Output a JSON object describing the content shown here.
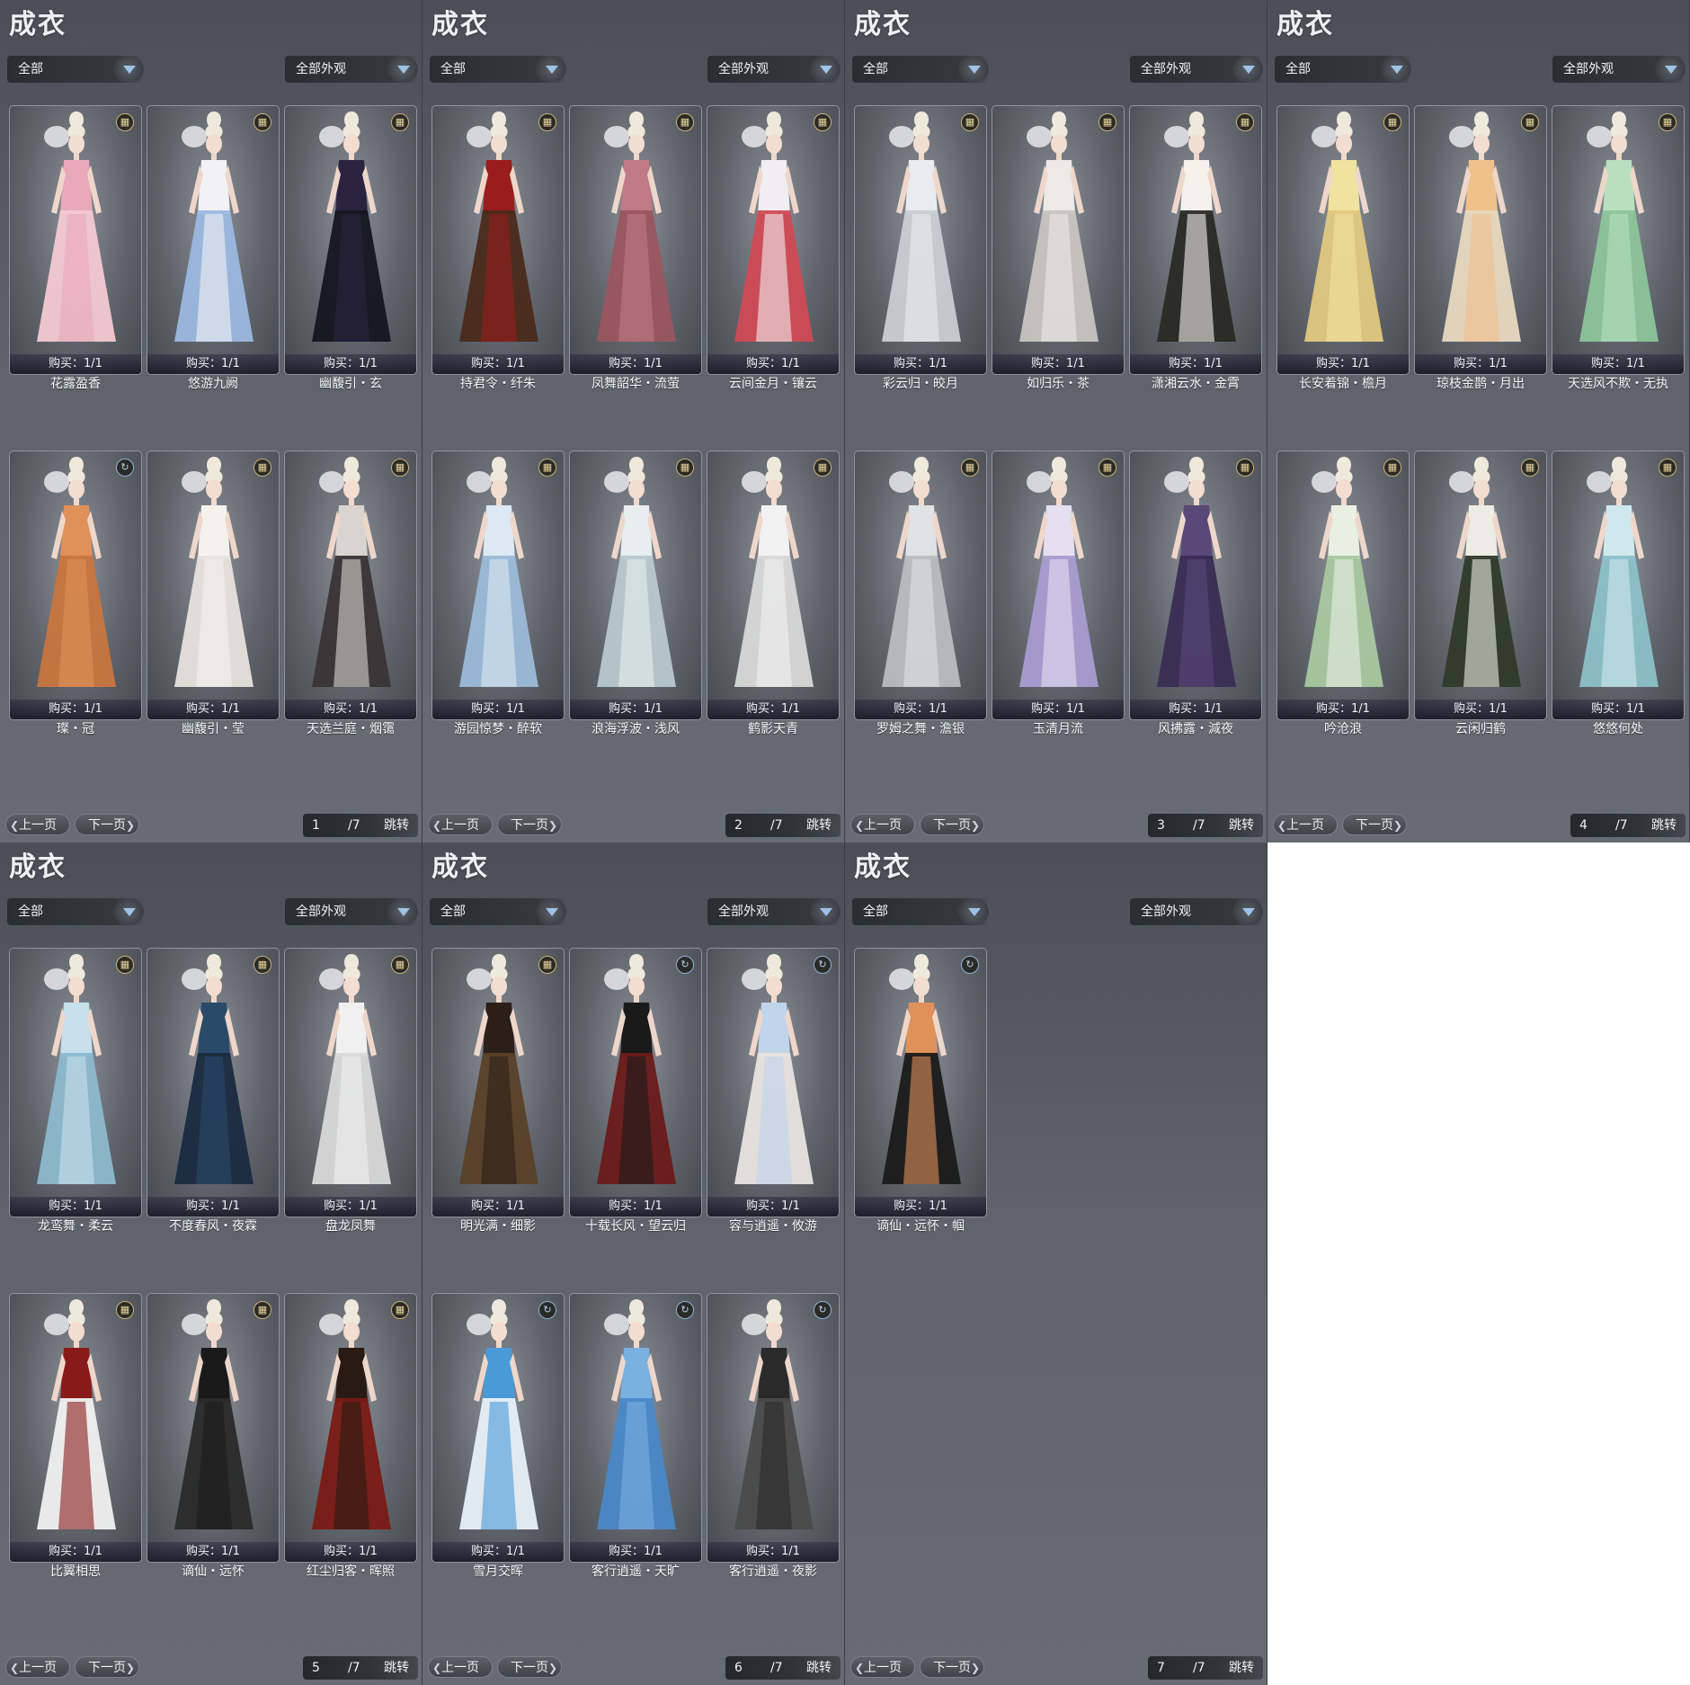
{
  "panel_title": "成衣",
  "filter_left": "全部",
  "filter_right": "全部外观",
  "prev_label": "上一页",
  "next_label": "下一页",
  "jump_label": "跳转",
  "total_pages": "/7",
  "panels": [
    {
      "page": "1",
      "items": [
        {
          "name": "花露盈香",
          "buy": "购买：1/1",
          "icon": "trash-icon",
          "colors": [
            "#e9a9b8",
            "#f3c9d2"
          ]
        },
        {
          "name": "悠游九阙",
          "buy": "购买：1/1",
          "icon": "trash-icon",
          "colors": [
            "#f2f2f4",
            "#9bb8e0"
          ]
        },
        {
          "name": "幽馥引・玄",
          "buy": "购买：1/1",
          "icon": "trash-icon",
          "colors": [
            "#2a2440",
            "#151520"
          ]
        },
        {
          "name": "璨・冠",
          "buy": "购买：1/1",
          "icon": "refresh-icon",
          "colors": [
            "#e0915a",
            "#c8763e"
          ]
        },
        {
          "name": "幽馥引・莹",
          "buy": "购买：1/1",
          "icon": "trash-icon",
          "colors": [
            "#f5f2ee",
            "#e8e2dc"
          ]
        },
        {
          "name": "天选兰庭・烟霭",
          "buy": "购买：1/1",
          "icon": "trash-icon",
          "colors": [
            "#d9d4cf",
            "#3a3436"
          ]
        }
      ]
    },
    {
      "page": "2",
      "items": [
        {
          "name": "持君令・纤朱",
          "buy": "购买：1/1",
          "icon": "trash-icon",
          "colors": [
            "#9a1d1d",
            "#4a2a1a"
          ]
        },
        {
          "name": "凤舞韶华・流萤",
          "buy": "购买：1/1",
          "icon": "trash-icon",
          "colors": [
            "#c07a86",
            "#9a5560"
          ]
        },
        {
          "name": "云间金月・镶云",
          "buy": "购买：1/1",
          "icon": "trash-icon",
          "colors": [
            "#f0eef0",
            "#d04a55"
          ]
        },
        {
          "name": "游园惊梦・醉软",
          "buy": "购买：1/1",
          "icon": "trash-icon",
          "colors": [
            "#dce8f4",
            "#9bbad8"
          ]
        },
        {
          "name": "浪海浮波・浅风",
          "buy": "购买：1/1",
          "icon": "trash-icon",
          "colors": [
            "#e6eef0",
            "#b8c8cc"
          ]
        },
        {
          "name": "鹤影天青",
          "buy": "购买：1/1",
          "icon": "trash-icon",
          "colors": [
            "#f2f2f2",
            "#d8d8d8"
          ]
        }
      ]
    },
    {
      "page": "3",
      "items": [
        {
          "name": "彩云归・皎月",
          "buy": "购买：1/1",
          "icon": "trash-icon",
          "colors": [
            "#e8ecf0",
            "#c8ced4"
          ]
        },
        {
          "name": "如归乐・茶",
          "buy": "购买：1/1",
          "icon": "trash-icon",
          "colors": [
            "#eceae8",
            "#c8c4c0"
          ]
        },
        {
          "name": "潇湘云水・金霄",
          "buy": "购买：1/1",
          "icon": "trash-icon",
          "colors": [
            "#f4f2ea",
            "#2a2a24"
          ]
        },
        {
          "name": "罗姆之舞・澹银",
          "buy": "购买：1/1",
          "icon": "trash-icon",
          "colors": [
            "#e0e2e4",
            "#b8bcc0"
          ]
        },
        {
          "name": "玉清月流",
          "buy": "购买：1/1",
          "icon": "trash-icon",
          "colors": [
            "#e4e0f0",
            "#a89cd0"
          ]
        },
        {
          "name": "风拂露・減夜",
          "buy": "购买：1/1",
          "icon": "trash-icon",
          "colors": [
            "#5a4878",
            "#3a2c54"
          ]
        }
      ]
    },
    {
      "page": "4",
      "items": [
        {
          "name": "长安着锦・檐月",
          "buy": "购买：1/1",
          "icon": "trash-icon",
          "colors": [
            "#f2e2a0",
            "#e0c880"
          ]
        },
        {
          "name": "琼枝金鹊・月出",
          "buy": "购买：1/1",
          "icon": "trash-icon",
          "colors": [
            "#f0c08a",
            "#e8d8c0"
          ]
        },
        {
          "name": "天选风不欺・无执",
          "buy": "购买：1/1",
          "icon": "trash-icon",
          "colors": [
            "#b8e0c0",
            "#8cc49a"
          ]
        },
        {
          "name": "吟沧浪",
          "buy": "购买：1/1",
          "icon": "trash-icon",
          "colors": [
            "#e8f0e4",
            "#a8c8a0"
          ]
        },
        {
          "name": "云闲归鹤",
          "buy": "购买：1/1",
          "icon": "trash-icon",
          "colors": [
            "#ecece4",
            "#2e3a2a"
          ]
        },
        {
          "name": "悠悠何处",
          "buy": "购买：1/1",
          "icon": "trash-icon",
          "colors": [
            "#cfe8ec",
            "#8cc0c8"
          ]
        }
      ]
    },
    {
      "page": "5",
      "items": [
        {
          "name": "龙鸾舞・柔云",
          "buy": "购买：1/1",
          "icon": "trash-icon",
          "colors": [
            "#c8e0ec",
            "#8cb8cc"
          ]
        },
        {
          "name": "不度春风・夜霖",
          "buy": "购买：1/1",
          "icon": "trash-icon",
          "colors": [
            "#2a4a6a",
            "#1a2a40"
          ]
        },
        {
          "name": "盘龙凤舞",
          "buy": "购买：1/1",
          "icon": "trash-icon",
          "colors": [
            "#f0f0f0",
            "#d8d8d8"
          ]
        },
        {
          "name": "比翼相思",
          "buy": "购买：1/1",
          "icon": "trash-icon",
          "colors": [
            "#8a1a1a",
            "#f0f0f0"
          ]
        },
        {
          "name": "谪仙・远怀",
          "buy": "购买：1/1",
          "icon": "trash-icon",
          "colors": [
            "#1a1a1a",
            "#2a2a2a"
          ]
        },
        {
          "name": "红尘归客・晖照",
          "buy": "购买：1/1",
          "icon": "trash-icon",
          "colors": [
            "#2a1a14",
            "#7a1a14"
          ]
        }
      ]
    },
    {
      "page": "6",
      "items": [
        {
          "name": "明光满・细影",
          "buy": "购买：1/1",
          "icon": "trash-icon",
          "colors": [
            "#2a2018",
            "#5a4028"
          ]
        },
        {
          "name": "十载长风・望云归",
          "buy": "购买：1/1",
          "icon": "refresh-icon",
          "colors": [
            "#1a1a1a",
            "#6a1a1a"
          ]
        },
        {
          "name": "容与逍遥・攸游",
          "buy": "购买：1/1",
          "icon": "refresh-icon",
          "colors": [
            "#c0d4ec",
            "#e8e4e0"
          ]
        },
        {
          "name": "雪月交晖",
          "buy": "购买：1/1",
          "icon": "refresh-icon",
          "colors": [
            "#4a9ad8",
            "#e8f0f8"
          ]
        },
        {
          "name": "客行逍遥・天旷",
          "buy": "购买：1/1",
          "icon": "refresh-icon",
          "colors": [
            "#7ab0e0",
            "#4a88c8"
          ]
        },
        {
          "name": "客行逍遥・夜影",
          "buy": "购买：1/1",
          "icon": "refresh-icon",
          "colors": [
            "#2a2a2a",
            "#4a4a4a"
          ]
        }
      ]
    },
    {
      "page": "7",
      "items": [
        {
          "name": "谪仙・远怀・帼",
          "buy": "购买：1/1",
          "icon": "refresh-icon",
          "colors": [
            "#e0915a",
            "#1a1a1a"
          ]
        }
      ]
    }
  ]
}
